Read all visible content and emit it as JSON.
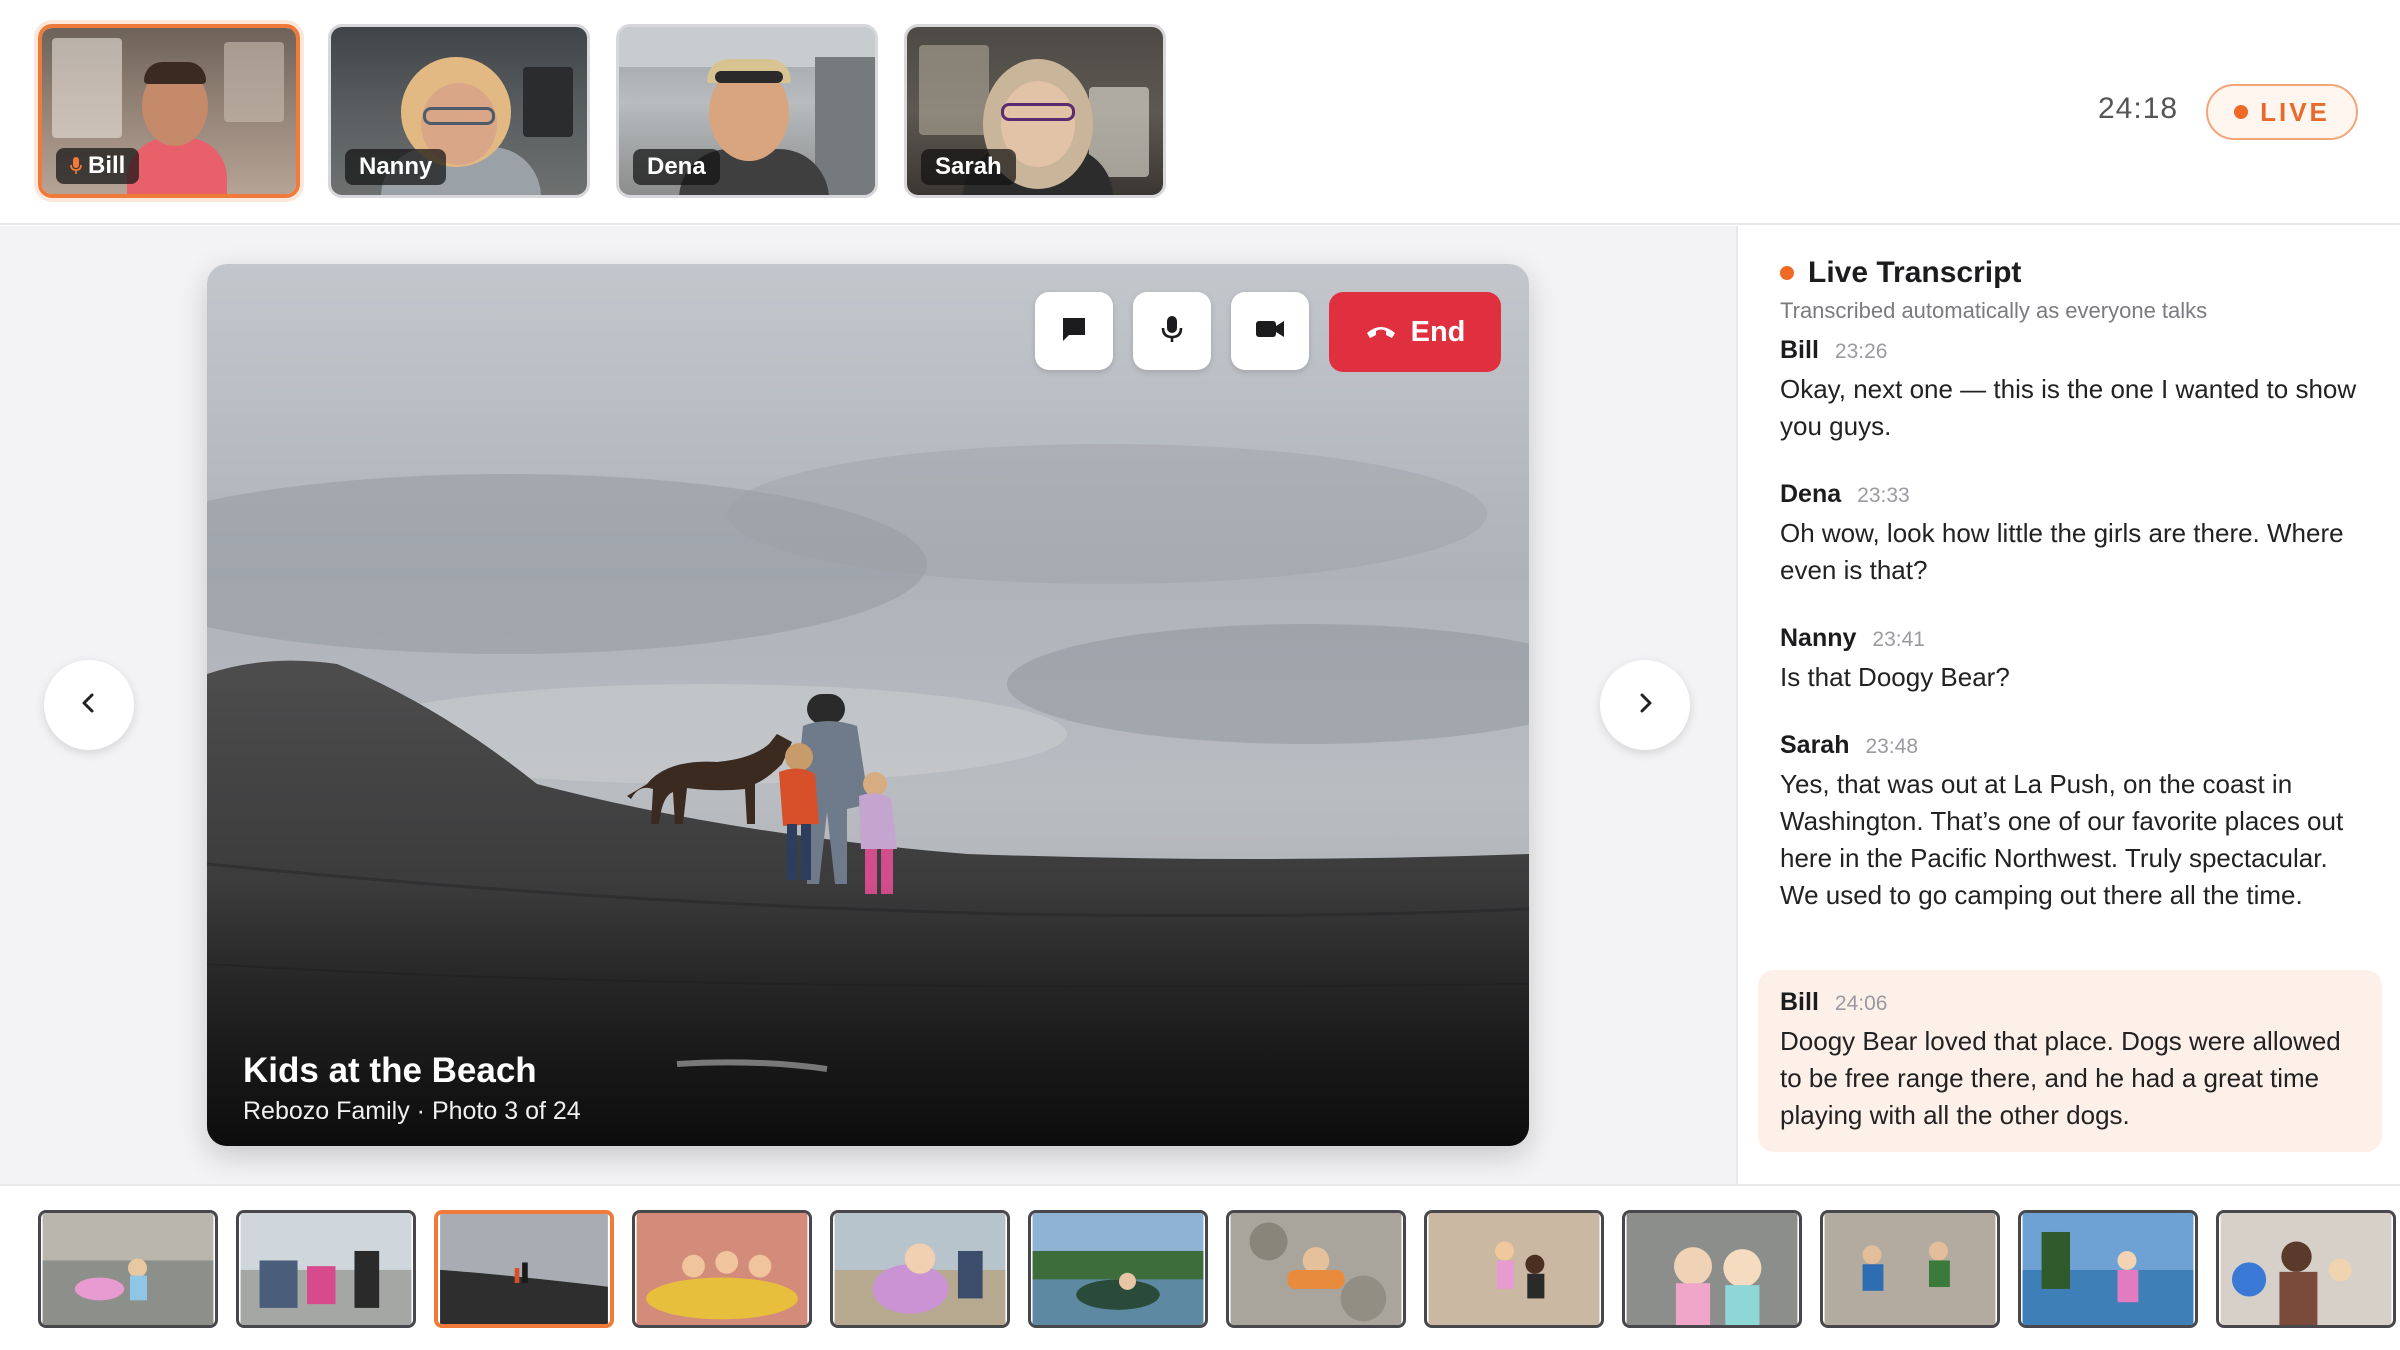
{
  "participants": [
    {
      "name": "Bill",
      "speaking": true
    },
    {
      "name": "Nanny",
      "speaking": false
    },
    {
      "name": "Dena",
      "speaking": false
    },
    {
      "name": "Sarah",
      "speaking": false
    }
  ],
  "call": {
    "elapsed": "24:18",
    "live_label": "LIVE",
    "end_label": "End"
  },
  "photo": {
    "title": "Kids at the Beach",
    "subtitle": "Rebozo Family · Photo 3 of 24",
    "current_index": 3,
    "total": 24
  },
  "transcript": {
    "title": "Live Transcript",
    "subtitle": "Transcribed automatically as everyone talks",
    "messages": [
      {
        "speaker": "Bill",
        "time": "23:26",
        "text": "Okay, next one — this is the one I wanted to show you guys."
      },
      {
        "speaker": "Dena",
        "time": "23:33",
        "text": "Oh wow, look how little the girls are there. Where even is that?"
      },
      {
        "speaker": "Nanny",
        "time": "23:41",
        "text": "Is that Doogy Bear?"
      },
      {
        "speaker": "Sarah",
        "time": "23:48",
        "text": "Yes, that was out at La Push, on the coast in Washington. That’s one of our favorite places out here in the Pacific Northwest. Truly spectacular. We used to go camping out there all the time."
      },
      {
        "speaker": "Bill",
        "time": "24:06",
        "text": "Doogy Bear loved that place. Dogs were allowed to be free range there, and he had a great time playing with all the other dogs."
      }
    ]
  },
  "colors": {
    "accent": "#f07a3a",
    "end_button": "#e0303f",
    "live": "#ee6a25",
    "highlight_bg": "#fdf0e8"
  },
  "icons": [
    "mic-icon",
    "chat-icon",
    "camera-icon",
    "phone-hangup-icon",
    "chevron-left-icon",
    "chevron-right-icon"
  ]
}
